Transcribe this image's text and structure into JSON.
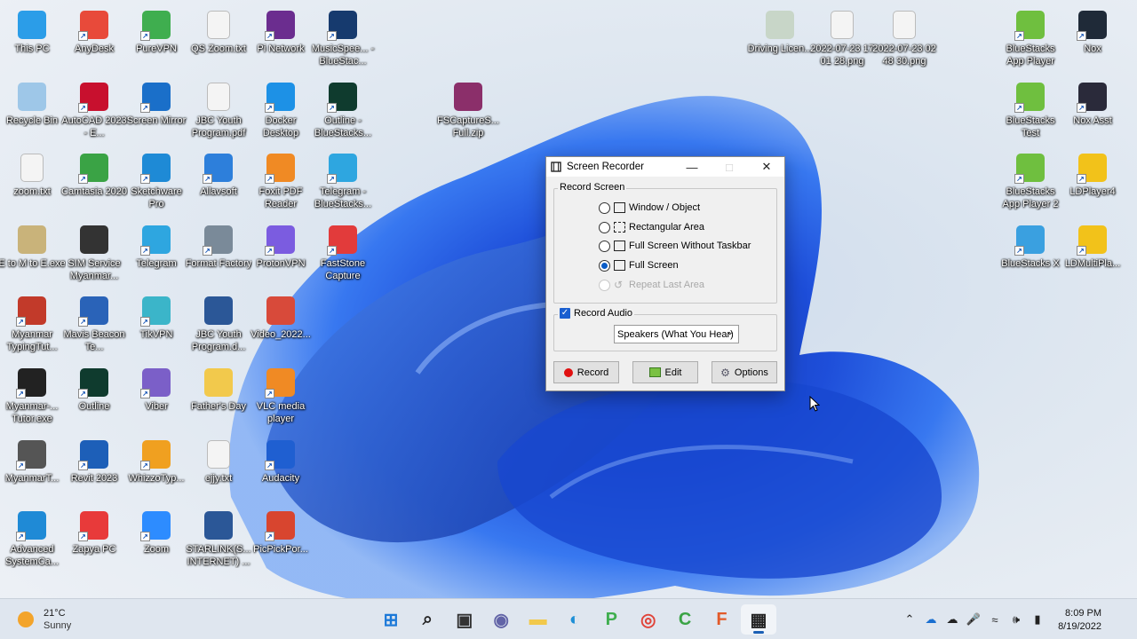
{
  "desktop": {
    "icons": [
      {
        "label": "This PC",
        "icon": "this-pc-icon",
        "color": "#2b9de8"
      },
      {
        "label": "AnyDesk",
        "icon": "anydesk-icon",
        "color": "#e84a3a"
      },
      {
        "label": "PureVPN",
        "icon": "purevpn-icon",
        "color": "#3fae4f"
      },
      {
        "label": "QS Zoom.txt",
        "icon": "text-file-icon",
        "color": "#f4f4f4"
      },
      {
        "label": "Pi Network",
        "icon": "pi-network-icon",
        "color": "#6b2d8f"
      },
      {
        "label": "MusicSpee... - BlueStac...",
        "icon": "musicspeed-icon",
        "color": "#163a6e"
      },
      {
        "label": "Recycle Bin",
        "icon": "recycle-bin-icon",
        "color": "#9ec7e8"
      },
      {
        "label": "AutoCAD 2023 - E...",
        "icon": "autocad-icon",
        "color": "#c8102e"
      },
      {
        "label": "Screen Mirror",
        "icon": "screen-mirror-icon",
        "color": "#1a6fc9"
      },
      {
        "label": "JBC Youth Program.pdf",
        "icon": "pdf-file-icon",
        "color": "#f4f4f4"
      },
      {
        "label": "Docker Desktop",
        "icon": "docker-icon",
        "color": "#1d91e6"
      },
      {
        "label": "Outline - BlueStacks...",
        "icon": "outline-icon",
        "color": "#0f3b2e"
      },
      {
        "label": "zoom.txt",
        "icon": "text-file-icon",
        "color": "#f4f4f4"
      },
      {
        "label": "Camtasia 2020",
        "icon": "camtasia-icon",
        "color": "#3aa345"
      },
      {
        "label": "Sketchware Pro",
        "icon": "sketchware-icon",
        "color": "#1e8ad6"
      },
      {
        "label": "Allavsoft",
        "icon": "allavsoft-icon",
        "color": "#2d7fdb"
      },
      {
        "label": "Foxit PDF Reader",
        "icon": "foxit-icon",
        "color": "#f08a24"
      },
      {
        "label": "Telegram - BlueStacks...",
        "icon": "telegram-icon",
        "color": "#2ea6e0"
      },
      {
        "label": "E to M to E.exe",
        "icon": "exe-icon",
        "color": "#c9b37a"
      },
      {
        "label": "SIM Service Myanmar...",
        "icon": "film-icon",
        "color": "#333333"
      },
      {
        "label": "Telegram",
        "icon": "telegram-icon",
        "color": "#2ea6e0"
      },
      {
        "label": "Format Factory",
        "icon": "format-factory-icon",
        "color": "#7a8a99"
      },
      {
        "label": "ProtonVPN",
        "icon": "protonvpn-icon",
        "color": "#7b5ce0"
      },
      {
        "label": "FastStone Capture",
        "icon": "faststone-icon",
        "color": "#e23b3b"
      },
      {
        "label": "Myanmar TypingTut...",
        "icon": "bicycle-icon",
        "color": "#c23a2a"
      },
      {
        "label": "Mavis Beacon Te...",
        "icon": "mavis-beacon-icon",
        "color": "#2a63b8"
      },
      {
        "label": "TikVPN",
        "icon": "tikvpn-icon",
        "color": "#3bb5c9"
      },
      {
        "label": "JBC Youth Program.d...",
        "icon": "word-file-icon",
        "color": "#2b5797"
      },
      {
        "label": "Video_2022...",
        "icon": "video-file-icon",
        "color": "#d84a3a"
      },
      {
        "label": "Myanmar-... Tutor.exe",
        "icon": "flash-icon",
        "color": "#222222"
      },
      {
        "label": "Outline",
        "icon": "outline-icon",
        "color": "#0f3b2e"
      },
      {
        "label": "Viber",
        "icon": "viber-icon",
        "color": "#7b5fc8"
      },
      {
        "label": "Father's Day",
        "icon": "folder-icon",
        "color": "#f2c94c"
      },
      {
        "label": "VLC media player",
        "icon": "vlc-icon",
        "color": "#f08a24"
      },
      {
        "label": "MyanmarT...",
        "icon": "keyboard-icon",
        "color": "#555555"
      },
      {
        "label": "Revit 2023",
        "icon": "revit-icon",
        "color": "#1d5fb8"
      },
      {
        "label": "WhizzoTyp...",
        "icon": "whizzo-icon",
        "color": "#f0a020"
      },
      {
        "label": "ejjy.txt",
        "icon": "text-file-icon",
        "color": "#f4f4f4"
      },
      {
        "label": "Audacity",
        "icon": "audacity-icon",
        "color": "#1f5fd1"
      },
      {
        "label": "Advanced SystemCa...",
        "icon": "advanced-systemcare-icon",
        "color": "#1f8ad6"
      },
      {
        "label": "Zapya PC",
        "icon": "zapya-icon",
        "color": "#e83a3a"
      },
      {
        "label": "Zoom",
        "icon": "zoom-icon",
        "color": "#2d8cff"
      },
      {
        "label": "STARLINK(S... INTERNET) ...",
        "icon": "word-file-icon",
        "color": "#2b5797"
      },
      {
        "label": "PicPickPor...",
        "icon": "picpick-icon",
        "color": "#d8452f"
      },
      {
        "label": "FSCaptureS... Full.zip",
        "icon": "winrar-icon",
        "color": "#8b2f6a"
      },
      {
        "label": "Driving Licen...",
        "icon": "image-file-icon",
        "color": "#c8d6c8"
      },
      {
        "label": "2022-07-23 17 01 28.png",
        "icon": "image-file-icon",
        "color": "#f4f4f4"
      },
      {
        "label": "2022-07-23 02 48 30.png",
        "icon": "image-file-icon",
        "color": "#f4f4f4"
      },
      {
        "label": "BlueStacks App Player",
        "icon": "bluestacks-icon",
        "color": "#6fbf3f"
      },
      {
        "label": "Nox",
        "icon": "nox-icon",
        "color": "#1f2a38"
      },
      {
        "label": "BlueStacks Test",
        "icon": "bluestacks-icon",
        "color": "#6fbf3f"
      },
      {
        "label": "Nox Asst",
        "icon": "nox-icon",
        "color": "#2a2a3a"
      },
      {
        "label": "BlueStacks App Player 2",
        "icon": "bluestacks-icon",
        "color": "#6fbf3f"
      },
      {
        "label": "LDPlayer4",
        "icon": "ldplayer-icon",
        "color": "#f2c21a"
      },
      {
        "label": "BlueStacks X",
        "icon": "bluestacks-x-icon",
        "color": "#3aa0e0"
      },
      {
        "label": "LDMultiPla...",
        "icon": "ldmultiplayer-icon",
        "color": "#f2c21a"
      }
    ]
  },
  "dialog": {
    "title": "Screen Recorder",
    "record_screen_label": "Record Screen",
    "options": [
      {
        "label": "Window / Object",
        "selected": false,
        "disabled": false
      },
      {
        "label": "Rectangular Area",
        "selected": false,
        "disabled": false
      },
      {
        "label": "Full Screen Without Taskbar",
        "selected": false,
        "disabled": false
      },
      {
        "label": "Full Screen",
        "selected": true,
        "disabled": false
      },
      {
        "label": "Repeat Last Area",
        "selected": false,
        "disabled": true
      }
    ],
    "record_audio_label": "Record Audio",
    "record_audio_checked": true,
    "audio_source": "Speakers (What You Hear)",
    "buttons": {
      "record": "Record",
      "edit": "Edit",
      "options": "Options"
    }
  },
  "taskbar": {
    "weather": {
      "temp": "21°C",
      "condition": "Sunny"
    },
    "apps": [
      {
        "icon": "start-icon",
        "active": false
      },
      {
        "icon": "search-icon",
        "active": false
      },
      {
        "icon": "task-view-icon",
        "active": false
      },
      {
        "icon": "teams-chat-icon",
        "active": false
      },
      {
        "icon": "file-explorer-icon",
        "active": false
      },
      {
        "icon": "edge-icon",
        "active": false
      },
      {
        "icon": "purevpn-icon",
        "active": false
      },
      {
        "icon": "chrome-icon",
        "active": false
      },
      {
        "icon": "camtasia-icon",
        "active": false
      },
      {
        "icon": "faststone-icon",
        "active": false
      },
      {
        "icon": "screen-recorder-icon",
        "active": true
      }
    ],
    "clock": {
      "time": "8:09 PM",
      "date": "8/19/2022"
    }
  }
}
